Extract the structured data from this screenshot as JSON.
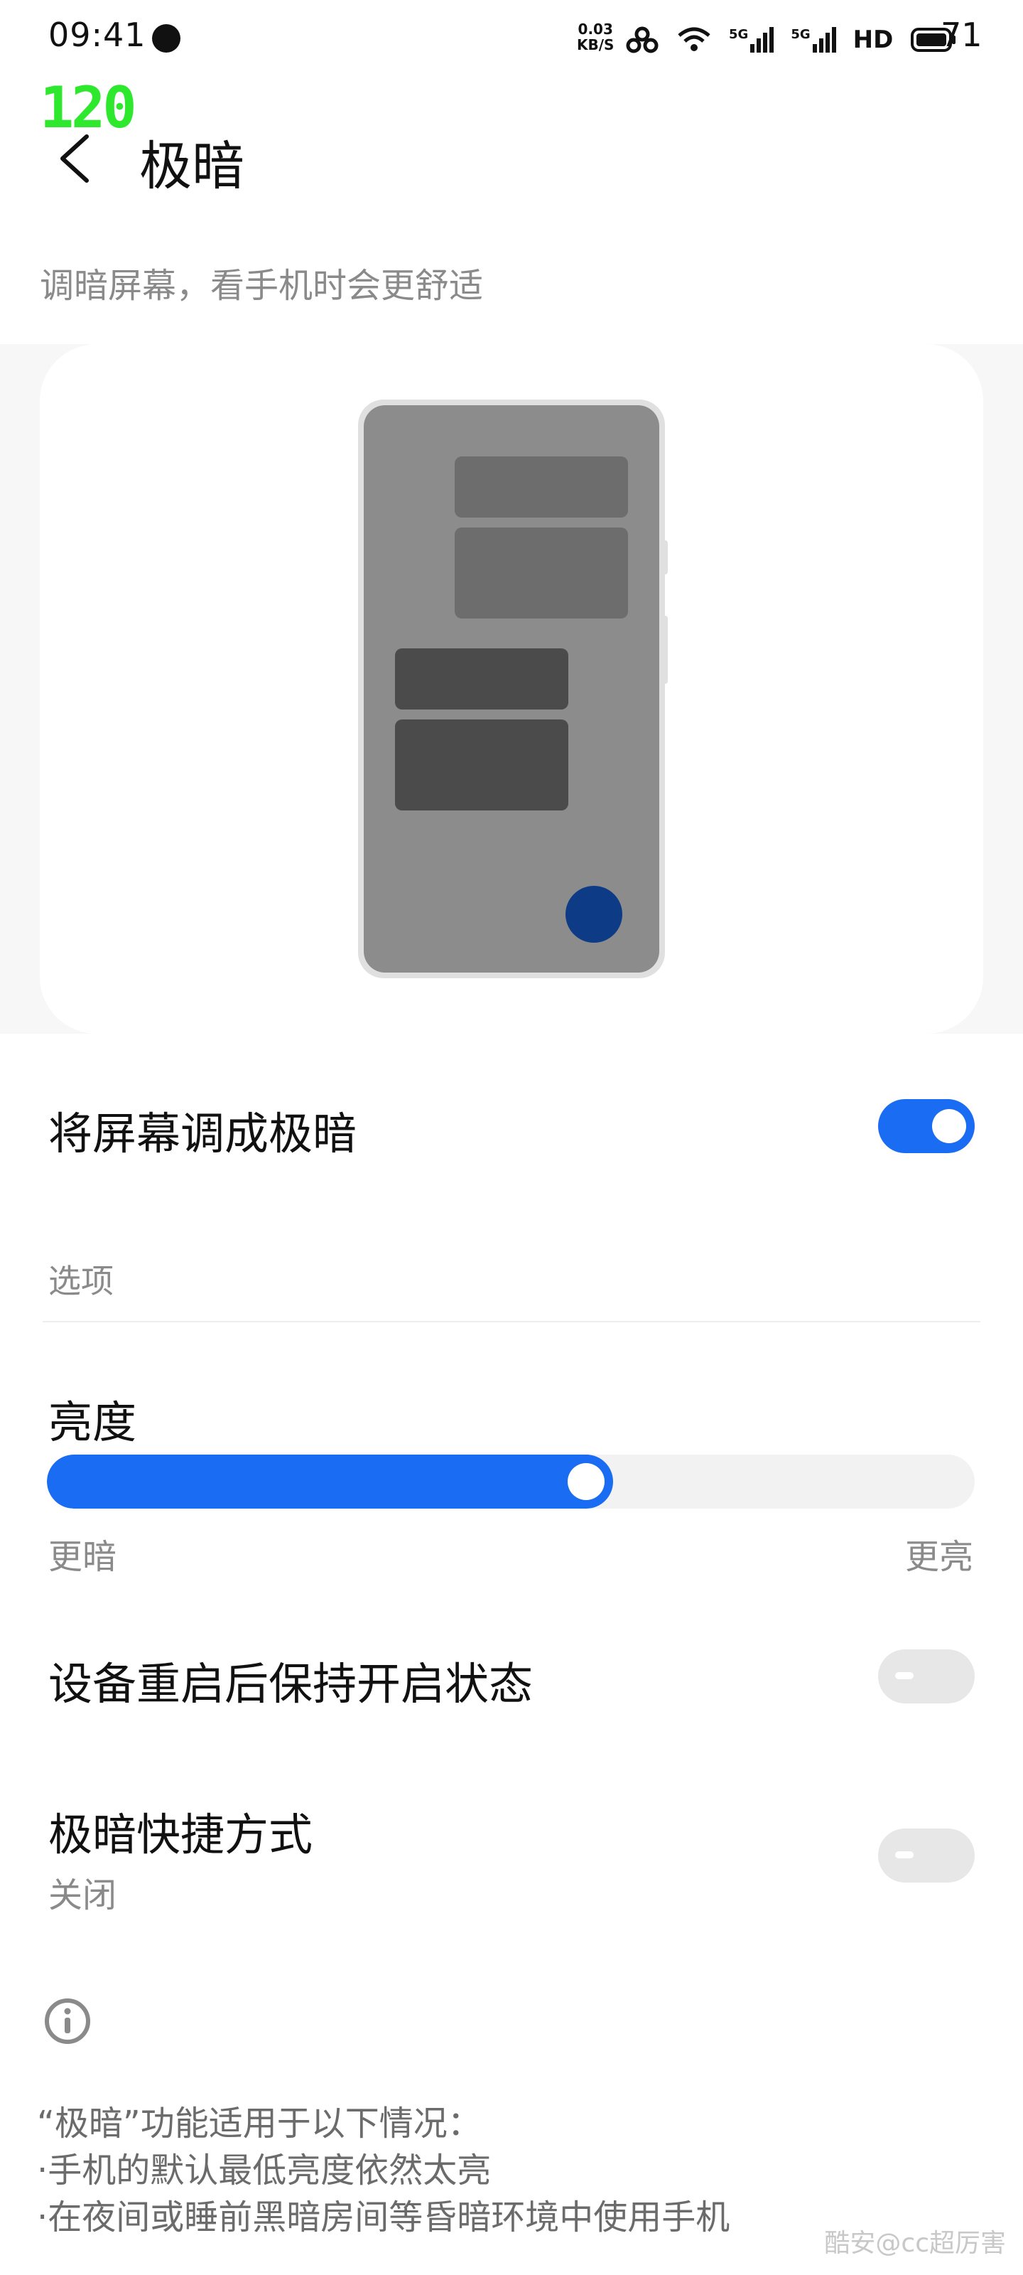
{
  "status_bar": {
    "time": "09:41",
    "net_speed_top": "0.03",
    "net_speed_bottom": "KB/S",
    "signal_1": "5G",
    "signal_2": "5G",
    "hd": "HD",
    "battery": "71",
    "icons": [
      "chat-bubble-icon",
      "hotspot-icon",
      "wifi-icon",
      "signal-icon",
      "battery-icon"
    ]
  },
  "fps_badge": "120",
  "header": {
    "title": "极暗",
    "subtitle": "调暗屏幕，看手机时会更舒适"
  },
  "main_toggle": {
    "label": "将屏幕调成极暗",
    "state": "on"
  },
  "options_section": "选项",
  "brightness": {
    "label": "亮度",
    "min_label": "更暗",
    "max_label": "更亮",
    "value": 0.61
  },
  "keep_on_restart": {
    "label": "设备重启后保持开启状态",
    "state": "off"
  },
  "shortcut": {
    "label": "极暗快捷方式",
    "sub": "关闭",
    "state": "off"
  },
  "info": {
    "line1": "“极暗”功能适用于以下情况：",
    "line2": "·手机的默认最低亮度依然太亮",
    "line3": "·在夜间或睡前黑暗房间等昏暗环境中使用手机"
  },
  "watermark": "酷安@cc超厉害",
  "colors": {
    "accent": "#1a6cf2",
    "fab": "#0e3b86",
    "fps": "#2ee82e"
  }
}
